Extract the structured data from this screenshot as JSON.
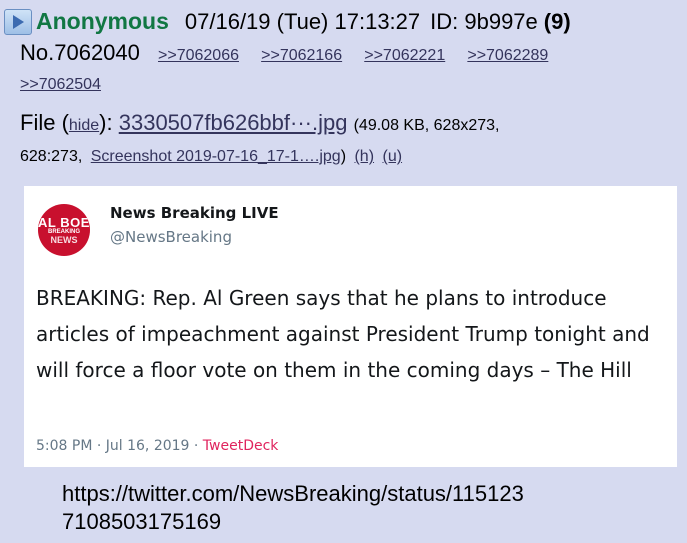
{
  "post": {
    "name": "Anonymous",
    "datetime": "07/16/19 (Tue) 17:13:27",
    "id_label": "ID: 9b997e",
    "count": "(9)",
    "number": "No.7062040",
    "replies": [
      ">>7062066",
      ">>7062166",
      ">>7062221",
      ">>7062289",
      ">>7062504"
    ],
    "file": {
      "label": "File",
      "open_paren": "(",
      "hide_label": "hide",
      "close_colon": "):",
      "filename": "3330507fb626bbf···.jpg",
      "info_start": "(49.08 KB, 628x273,",
      "info_res": "628:273,",
      "original_name": "Screenshot 2019-07-16_17-1….jpg",
      "close_paren": ")",
      "h_label": "(h)",
      "u_label": "(u)"
    }
  },
  "tweet": {
    "avatar_line1": "AL BOE",
    "avatar_line2": "BREAKING",
    "avatar_line3": "NEWS",
    "display_name": "News Breaking LIVE",
    "handle": "@NewsBreaking",
    "text": "BREAKING: Rep. Al Green says that he plans to introduce articles of impeachment against President Trump tonight and will force a floor vote on them in the coming days – The Hill",
    "time": "5:08 PM · Jul 16, 2019 · ",
    "source": "TweetDeck"
  },
  "url_line1": "https://twitter.com/NewsBreaking/status/115123",
  "url_line2": "7108503175169",
  "colors": {
    "background": "#d6daf0",
    "name": "#117743",
    "link": "#34345c",
    "tweet_source": "#e0245e",
    "avatar": "#c8102e"
  }
}
